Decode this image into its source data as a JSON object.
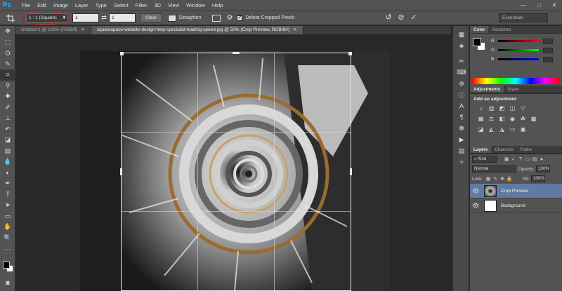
{
  "app": {
    "logo": "Ps"
  },
  "menu": [
    "File",
    "Edit",
    "Image",
    "Layer",
    "Type",
    "Select",
    "Filter",
    "3D",
    "View",
    "Window",
    "Help"
  ],
  "window_controls": [
    "—",
    "□",
    "✕"
  ],
  "options": {
    "ratio_value": "1 : 1 (Square)",
    "width_value": "1",
    "height_value": "1",
    "clear_label": "Clear",
    "straighten_label": "Straighten",
    "delete_cropped_label": "Delete Cropped Pixels",
    "delete_cropped_checked": true,
    "workspace_label": "Essentials"
  },
  "tabs": [
    {
      "label": "Untitled-1 @ 100% (RGB/8)",
      "active": false
    },
    {
      "label": "squarespace-website-design-help-specialist-loading-speed.jpg @ 50% (Crop Preview, RGB/8#)",
      "active": true
    }
  ],
  "panels": {
    "color_tabs": [
      "Color",
      "Swatches"
    ],
    "color_sliders": [
      "R",
      "G",
      "B"
    ],
    "adjust_tabs": [
      "Adjustments",
      "Styles"
    ],
    "adjust_title": "Add an adjustment",
    "layers_tabs": [
      "Layers",
      "Channels",
      "Paths"
    ],
    "kind_label": "Kind",
    "blend_mode": "Normal",
    "opacity_label": "Opacity:",
    "opacity_value": "100%",
    "lock_label": "Lock:",
    "fill_label": "Fill:",
    "fill_value": "100%"
  },
  "layers": [
    {
      "name": "Crop Preview",
      "selected": true
    },
    {
      "name": "Background",
      "selected": false
    }
  ],
  "colors": {
    "accent": "#31a8ff",
    "selection": "#5f7ba3",
    "annotation": "#e02020"
  }
}
